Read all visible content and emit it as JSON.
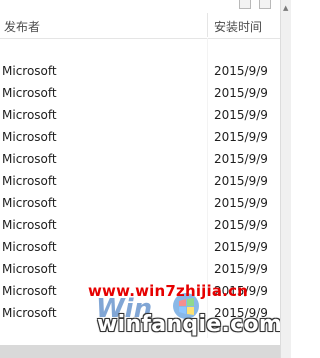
{
  "header": {
    "publisher_label": "发布者",
    "install_date_label": "安装时间"
  },
  "rows": [
    {
      "publisher": "Microsoft",
      "install_date": "2015/9/9"
    },
    {
      "publisher": "Microsoft",
      "install_date": "2015/9/9"
    },
    {
      "publisher": "Microsoft",
      "install_date": "2015/9/9"
    },
    {
      "publisher": "Microsoft",
      "install_date": "2015/9/9"
    },
    {
      "publisher": "Microsoft",
      "install_date": "2015/9/9"
    },
    {
      "publisher": "Microsoft",
      "install_date": "2015/9/9"
    },
    {
      "publisher": "Microsoft",
      "install_date": "2015/9/9"
    },
    {
      "publisher": "Microsoft",
      "install_date": "2015/9/9"
    },
    {
      "publisher": "Microsoft",
      "install_date": "2015/9/9"
    },
    {
      "publisher": "Microsoft",
      "install_date": "2015/9/9"
    },
    {
      "publisher": "Microsoft",
      "install_date": "2015/9/9"
    },
    {
      "publisher": "Microsoft",
      "install_date": "2015/9/9"
    }
  ],
  "watermark": {
    "site_url": "www.win7zhijia.cn",
    "site_domain": "winfanqie.com",
    "accent_color": "#e60000"
  }
}
